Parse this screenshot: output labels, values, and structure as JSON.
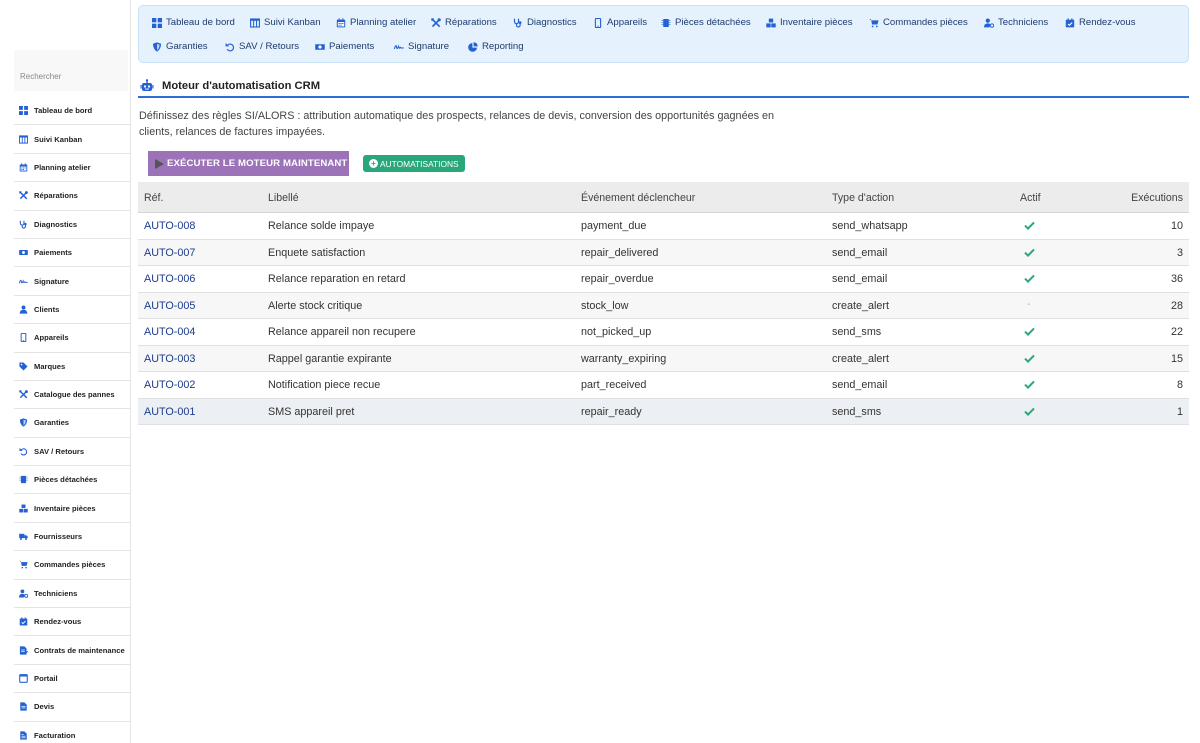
{
  "sidebar": {
    "search_placeholder": "Rechercher",
    "items": [
      {
        "label": "Tableau de bord",
        "icon": "grid-icon"
      },
      {
        "label": "Suivi Kanban",
        "icon": "kanban-icon"
      },
      {
        "label": "Planning atelier",
        "icon": "calendar-icon"
      },
      {
        "label": "Réparations",
        "icon": "tools-icon"
      },
      {
        "label": "Diagnostics",
        "icon": "stethoscope-icon"
      },
      {
        "label": "Paiements",
        "icon": "money-icon"
      },
      {
        "label": "Signature",
        "icon": "signature-icon"
      },
      {
        "label": "Clients",
        "icon": "user-icon"
      },
      {
        "label": "Appareils",
        "icon": "phone-icon"
      },
      {
        "label": "Marques",
        "icon": "tag-icon"
      },
      {
        "label": "Catalogue des pannes",
        "icon": "tools-icon"
      },
      {
        "label": "Garanties",
        "icon": "shield-icon"
      },
      {
        "label": "SAV / Retours",
        "icon": "undo-icon"
      },
      {
        "label": "Pièces détachées",
        "icon": "chip-icon"
      },
      {
        "label": "Inventaire pièces",
        "icon": "boxes-icon"
      },
      {
        "label": "Fournisseurs",
        "icon": "truck-icon"
      },
      {
        "label": "Commandes pièces",
        "icon": "cart-icon"
      },
      {
        "label": "Techniciens",
        "icon": "user-gear-icon"
      },
      {
        "label": "Rendez-vous",
        "icon": "calendar-check-icon"
      },
      {
        "label": "Contrats de maintenance",
        "icon": "contract-icon"
      },
      {
        "label": "Portail",
        "icon": "portal-icon"
      },
      {
        "label": "Devis",
        "icon": "document-icon"
      },
      {
        "label": "Facturation",
        "icon": "invoice-icon"
      }
    ]
  },
  "topnav": {
    "row1": [
      {
        "label": "Tableau de bord",
        "icon": "grid-icon"
      },
      {
        "label": "Suivi Kanban",
        "icon": "kanban-icon"
      },
      {
        "label": "Planning atelier",
        "icon": "calendar-icon"
      },
      {
        "label": "Réparations",
        "icon": "tools-icon"
      },
      {
        "label": "Diagnostics",
        "icon": "stethoscope-icon"
      },
      {
        "label": "Appareils",
        "icon": "phone-icon"
      },
      {
        "label": "Pièces détachées",
        "icon": "chip-icon"
      },
      {
        "label": "Inventaire pièces",
        "icon": "boxes-icon"
      },
      {
        "label": "Commandes pièces",
        "icon": "cart-icon"
      },
      {
        "label": "Techniciens",
        "icon": "user-gear-icon"
      },
      {
        "label": "Rendez-vous",
        "icon": "calendar-check-icon"
      }
    ],
    "row2": [
      {
        "label": "Garanties",
        "icon": "shield-icon"
      },
      {
        "label": "SAV / Retours",
        "icon": "undo-icon"
      },
      {
        "label": "Paiements",
        "icon": "money-icon"
      },
      {
        "label": "Signature",
        "icon": "signature-icon"
      },
      {
        "label": "Reporting",
        "icon": "pie-icon"
      }
    ]
  },
  "page": {
    "title": "Moteur d'automatisation CRM",
    "description": "Définissez des règles SI/ALORS : attribution automatique des prospects, relances de devis, conversion des opportunités gagnées en clients, relances de factures impayées.",
    "run_button": "EXÉCUTER LE MOTEUR MAINTENANT",
    "automations_badge": "AUTOMATISATIONS"
  },
  "table": {
    "headers": {
      "ref": "Réf.",
      "label": "Libellé",
      "event": "Événement déclencheur",
      "action": "Type d'action",
      "active": "Actif",
      "runs": "Exécutions"
    },
    "rows": [
      {
        "ref": "AUTO-008",
        "label": "Relance solde impaye",
        "event": "payment_due",
        "action": "send_whatsapp",
        "active": true,
        "runs": "10"
      },
      {
        "ref": "AUTO-007",
        "label": "Enquete satisfaction",
        "event": "repair_delivered",
        "action": "send_email",
        "active": true,
        "runs": "3"
      },
      {
        "ref": "AUTO-006",
        "label": "Relance reparation en retard",
        "event": "repair_overdue",
        "action": "send_email",
        "active": true,
        "runs": "36"
      },
      {
        "ref": "AUTO-005",
        "label": "Alerte stock critique",
        "event": "stock_low",
        "action": "create_alert",
        "active": false,
        "runs": "28"
      },
      {
        "ref": "AUTO-004",
        "label": "Relance appareil non recupere",
        "event": "not_picked_up",
        "action": "send_sms",
        "active": true,
        "runs": "22"
      },
      {
        "ref": "AUTO-003",
        "label": "Rappel garantie expirante",
        "event": "warranty_expiring",
        "action": "create_alert",
        "active": true,
        "runs": "15"
      },
      {
        "ref": "AUTO-002",
        "label": "Notification piece recue",
        "event": "part_received",
        "action": "send_email",
        "active": true,
        "runs": "8"
      },
      {
        "ref": "AUTO-001",
        "label": "SMS appareil pret",
        "event": "repair_ready",
        "action": "send_sms",
        "active": true,
        "runs": "1"
      }
    ],
    "inactive_marker": "-"
  },
  "colors": {
    "accent": "#2a6ed6",
    "nav_icon": "#2462d4",
    "run_button": "#9c73b8",
    "badge_green": "#28a77a",
    "check_green": "#2aa876",
    "topnav_bg": "#e5f2fd"
  }
}
